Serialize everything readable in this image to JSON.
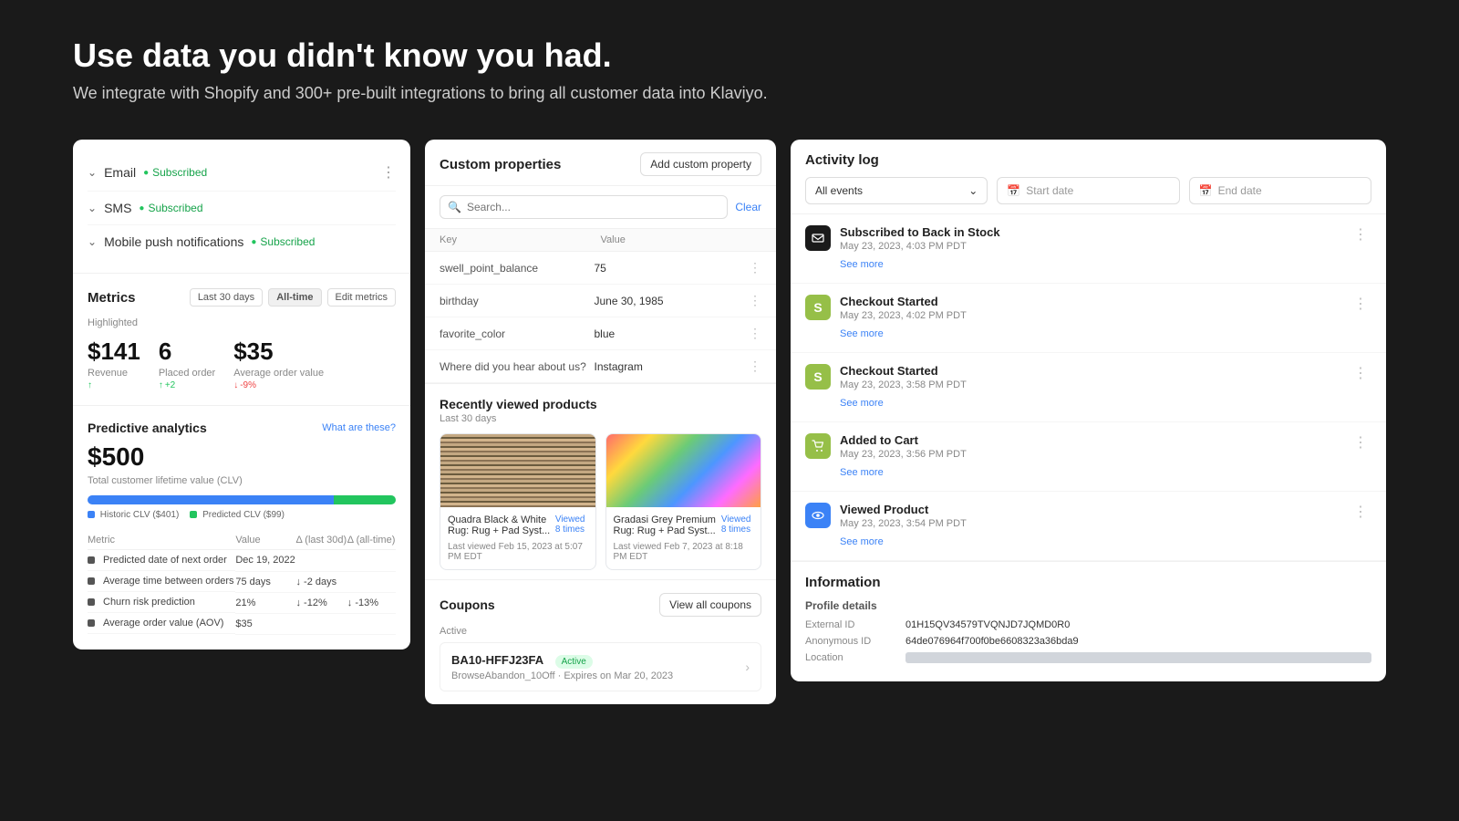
{
  "hero": {
    "title": "Use data you didn't know you had.",
    "subtitle": "We integrate with Shopify and 300+ pre-built integrations to bring all customer data into Klaviyo."
  },
  "left_card": {
    "subscriptions": [
      {
        "label": "Email",
        "status": "Subscribed"
      },
      {
        "label": "SMS",
        "status": "Subscribed"
      },
      {
        "label": "Mobile push notifications",
        "status": "Subscribed"
      }
    ],
    "metrics": {
      "title": "Metrics",
      "highlighted": "Highlighted",
      "btn_last30": "Last 30 days",
      "btn_alltime": "All-time",
      "btn_edit": "Edit metrics",
      "items": [
        {
          "value": "$141",
          "label": "Revenue",
          "change": ""
        },
        {
          "value": "6",
          "label": "Placed order",
          "change": "+2"
        },
        {
          "value": "$35",
          "label": "Average order value",
          "change": "-9%"
        }
      ]
    },
    "predictive": {
      "title": "Predictive analytics",
      "link": "What are these?",
      "value": "$500",
      "desc": "Total customer lifetime value (CLV)",
      "bar_historic_pct": 80,
      "bar_predicted_pct": 20,
      "legend_historic": "Historic CLV ($401)",
      "legend_predicted": "Predicted CLV ($99)",
      "table_headers": [
        "Metric",
        "Value",
        "Δ (last 30d)",
        "Δ (all-time)"
      ],
      "table_rows": [
        {
          "metric": "Predicted date of next order",
          "value": "Dec 19, 2022",
          "d30": "",
          "all": ""
        },
        {
          "metric": "Average time between orders",
          "value": "75 days",
          "d30": "-2 days",
          "d30_dir": "pos",
          "all": "",
          "all_dir": ""
        },
        {
          "metric": "Churn risk prediction",
          "value": "21%",
          "d30": "-12%",
          "d30_dir": "neg",
          "all": "-13%",
          "all_dir": "neg"
        },
        {
          "metric": "Average order value (AOV)",
          "value": "$35",
          "d30": "",
          "all": ""
        }
      ]
    }
  },
  "middle_card": {
    "custom_properties": {
      "title": "Custom properties",
      "btn_add": "Add custom property",
      "search_placeholder": "Search...",
      "clear_label": "Clear",
      "col_key": "Key",
      "col_value": "Value",
      "rows": [
        {
          "key": "swell_point_balance",
          "value": "75"
        },
        {
          "key": "birthday",
          "value": "June 30, 1985"
        },
        {
          "key": "favorite_color",
          "value": "blue"
        },
        {
          "key": "Where did you hear about us?",
          "value": "Instagram"
        }
      ]
    },
    "recently_viewed": {
      "title": "Recently viewed products",
      "period": "Last 30 days",
      "products": [
        {
          "name": "Quadra Black & White Rug: Rug + Pad Syst...",
          "viewed_count": "Viewed 8 times",
          "last_viewed": "Last viewed Feb 15, 2023 at 5:07 PM EDT",
          "style": "striped"
        },
        {
          "name": "Gradasi Grey Premium Rug: Rug + Pad Syst...",
          "viewed_count": "Viewed 8 times",
          "last_viewed": "Last viewed Feb 7, 2023 at 8:18 PM EDT",
          "style": "colorful"
        }
      ]
    },
    "coupons": {
      "title": "Coupons",
      "btn_view_all": "View all coupons",
      "active_label": "Active",
      "items": [
        {
          "code": "BA10-HFFJ23FA",
          "status": "Active",
          "desc": "BrowseAbandon_10Off · Expires on Mar 20, 2023"
        }
      ]
    }
  },
  "right_card": {
    "activity_log": {
      "title": "Activity log",
      "filter_label": "All events",
      "start_date_placeholder": "Start date",
      "end_date_placeholder": "End date",
      "events": [
        {
          "icon": "envelope",
          "icon_type": "dark",
          "name": "Subscribed to Back in Stock",
          "time": "May 23, 2023, 4:03 PM PDT",
          "see_more": "See more"
        },
        {
          "icon": "S",
          "icon_type": "shopify",
          "name": "Checkout Started",
          "time": "May 23, 2023, 4:02 PM PDT",
          "see_more": "See more"
        },
        {
          "icon": "S",
          "icon_type": "shopify",
          "name": "Checkout Started",
          "time": "May 23, 2023, 3:58 PM PDT",
          "see_more": "See more"
        },
        {
          "icon": "cart",
          "icon_type": "cart",
          "name": "Added to Cart",
          "time": "May 23, 2023, 3:56 PM PDT",
          "see_more": "See more"
        },
        {
          "icon": "eye",
          "icon_type": "eye",
          "name": "Viewed Product",
          "time": "May 23, 2023, 3:54 PM PDT",
          "see_more": "See more"
        }
      ]
    },
    "information": {
      "title": "Information",
      "profile_details_label": "Profile details",
      "fields": [
        {
          "label": "External ID",
          "value": "01H15QV34579TVQNJD7JQMD0R0"
        },
        {
          "label": "Anonymous ID",
          "value": "64de076964f700f0be6608323a36bda9"
        },
        {
          "label": "Location",
          "value": ""
        }
      ]
    }
  }
}
